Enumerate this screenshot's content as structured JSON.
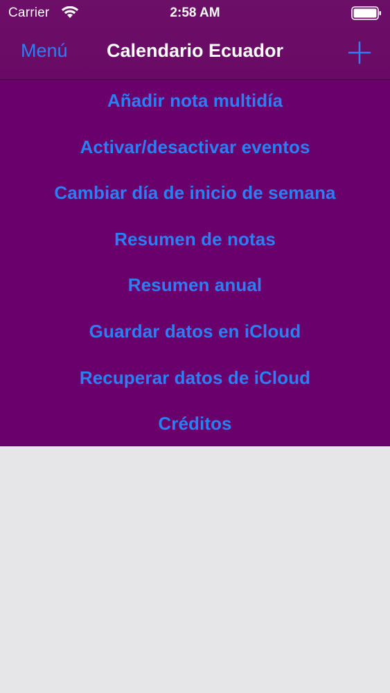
{
  "status_bar": {
    "carrier": "Carrier",
    "time": "2:58 AM"
  },
  "nav": {
    "menu_label": "Menú",
    "title": "Calendario Ecuador",
    "add_icon": "plus-icon"
  },
  "menu": {
    "items": [
      {
        "label": "Añadir nota multidía"
      },
      {
        "label": "Activar/desactivar eventos"
      },
      {
        "label": "Cambiar día de inicio de semana"
      },
      {
        "label": "Resumen de notas"
      },
      {
        "label": "Resumen anual"
      },
      {
        "label": "Guardar datos en iCloud"
      },
      {
        "label": "Recuperar datos de iCloud"
      },
      {
        "label": "Créditos"
      }
    ]
  },
  "colors": {
    "header_bg": "#6c0f67",
    "menu_bg": "#6a006c",
    "accent_blue": "#2d7ff6",
    "content_bg": "#e6e6e8"
  }
}
